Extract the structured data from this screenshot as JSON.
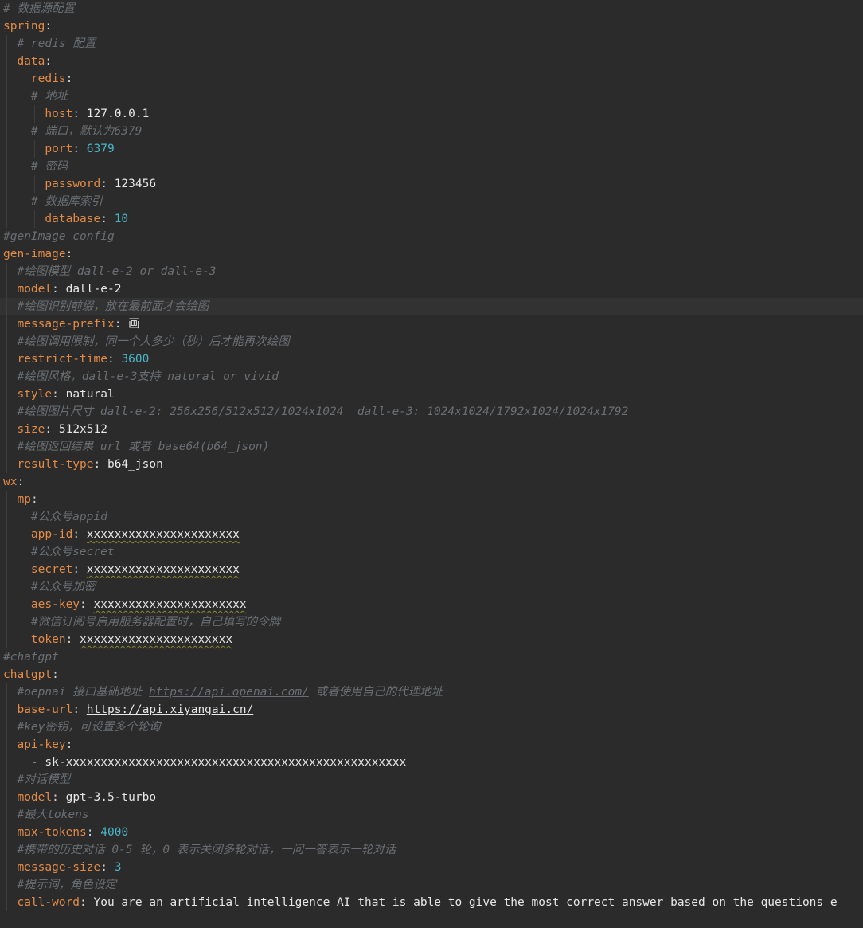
{
  "lines": [
    {
      "indent": 0,
      "parts": [
        {
          "t": "c",
          "v": "# 数据源配置"
        }
      ]
    },
    {
      "indent": 0,
      "parts": [
        {
          "t": "k",
          "v": "spring"
        },
        {
          "t": "p",
          "v": ":"
        }
      ]
    },
    {
      "indent": 1,
      "parts": [
        {
          "t": "c",
          "v": "# redis 配置"
        }
      ]
    },
    {
      "indent": 1,
      "parts": [
        {
          "t": "k",
          "v": "data"
        },
        {
          "t": "p",
          "v": ":"
        }
      ]
    },
    {
      "indent": 2,
      "parts": [
        {
          "t": "k",
          "v": "redis"
        },
        {
          "t": "p",
          "v": ":"
        }
      ]
    },
    {
      "indent": 2,
      "parts": [
        {
          "t": "c",
          "v": "# 地址"
        }
      ]
    },
    {
      "indent": 3,
      "parts": [
        {
          "t": "k",
          "v": "host"
        },
        {
          "t": "p",
          "v": ": "
        },
        {
          "t": "s",
          "v": "127.0.0.1"
        }
      ]
    },
    {
      "indent": 2,
      "parts": [
        {
          "t": "c",
          "v": "# 端口，默认为6379"
        }
      ]
    },
    {
      "indent": 3,
      "parts": [
        {
          "t": "k",
          "v": "port"
        },
        {
          "t": "p",
          "v": ": "
        },
        {
          "t": "n",
          "v": "6379"
        }
      ]
    },
    {
      "indent": 2,
      "parts": [
        {
          "t": "c",
          "v": "# 密码"
        }
      ]
    },
    {
      "indent": 3,
      "parts": [
        {
          "t": "k",
          "v": "password"
        },
        {
          "t": "p",
          "v": ": "
        },
        {
          "t": "s",
          "v": "123456"
        }
      ]
    },
    {
      "indent": 2,
      "parts": [
        {
          "t": "c",
          "v": "# 数据库索引"
        }
      ]
    },
    {
      "indent": 3,
      "parts": [
        {
          "t": "k",
          "v": "database"
        },
        {
          "t": "p",
          "v": ": "
        },
        {
          "t": "n",
          "v": "10"
        }
      ]
    },
    {
      "indent": 0,
      "parts": [
        {
          "t": "c",
          "v": "#genImage config"
        }
      ]
    },
    {
      "indent": 0,
      "parts": [
        {
          "t": "k",
          "v": "gen-image"
        },
        {
          "t": "p",
          "v": ":"
        }
      ]
    },
    {
      "indent": 1,
      "parts": [
        {
          "t": "c",
          "v": "#绘图模型 dall-e-2 or dall-e-3"
        }
      ]
    },
    {
      "indent": 1,
      "parts": [
        {
          "t": "k",
          "v": "model"
        },
        {
          "t": "p",
          "v": ": "
        },
        {
          "t": "s",
          "v": "dall-e-2"
        }
      ]
    },
    {
      "indent": 1,
      "current": true,
      "parts": [
        {
          "t": "c",
          "v": "#绘图识别前缀，放在最前面才会绘图"
        }
      ]
    },
    {
      "indent": 1,
      "parts": [
        {
          "t": "k",
          "v": "message-prefix"
        },
        {
          "t": "p",
          "v": ": "
        },
        {
          "t": "s",
          "v": "画"
        }
      ]
    },
    {
      "indent": 1,
      "parts": [
        {
          "t": "c",
          "v": "#绘图调用限制，同一个人多少（秒）后才能再次绘图"
        }
      ]
    },
    {
      "indent": 1,
      "parts": [
        {
          "t": "k",
          "v": "restrict-time"
        },
        {
          "t": "p",
          "v": ": "
        },
        {
          "t": "n",
          "v": "3600"
        }
      ]
    },
    {
      "indent": 1,
      "parts": [
        {
          "t": "c",
          "v": "#绘图风格，dall-e-3支持 natural or vivid"
        }
      ]
    },
    {
      "indent": 1,
      "parts": [
        {
          "t": "k",
          "v": "style"
        },
        {
          "t": "p",
          "v": ": "
        },
        {
          "t": "s",
          "v": "natural"
        }
      ]
    },
    {
      "indent": 1,
      "parts": [
        {
          "t": "c",
          "v": "#绘图图片尺寸 dall-e-2: 256x256/512x512/1024x1024  dall-e-3: 1024x1024/1792x1024/1024x1792"
        }
      ]
    },
    {
      "indent": 1,
      "parts": [
        {
          "t": "k",
          "v": "size"
        },
        {
          "t": "p",
          "v": ": "
        },
        {
          "t": "s",
          "v": "512x512"
        }
      ]
    },
    {
      "indent": 1,
      "parts": [
        {
          "t": "c",
          "v": "#绘图返回结果 url 或者 base64(b64_json)"
        }
      ]
    },
    {
      "indent": 1,
      "parts": [
        {
          "t": "k",
          "v": "result-type"
        },
        {
          "t": "p",
          "v": ": "
        },
        {
          "t": "s",
          "v": "b64_json"
        }
      ]
    },
    {
      "indent": 0,
      "parts": [
        {
          "t": "k",
          "v": "wx"
        },
        {
          "t": "p",
          "v": ":"
        }
      ]
    },
    {
      "indent": 1,
      "parts": [
        {
          "t": "k",
          "v": "mp"
        },
        {
          "t": "p",
          "v": ":"
        }
      ]
    },
    {
      "indent": 2,
      "parts": [
        {
          "t": "c",
          "v": "#公众号appid"
        }
      ]
    },
    {
      "indent": 2,
      "parts": [
        {
          "t": "k",
          "v": "app-id"
        },
        {
          "t": "p",
          "v": ": "
        },
        {
          "t": "sw",
          "v": "xxxxxxxxxxxxxxxxxxxxxx"
        }
      ]
    },
    {
      "indent": 2,
      "parts": [
        {
          "t": "c",
          "v": "#公众号secret"
        }
      ]
    },
    {
      "indent": 2,
      "parts": [
        {
          "t": "k",
          "v": "secret"
        },
        {
          "t": "p",
          "v": ": "
        },
        {
          "t": "sw",
          "v": "xxxxxxxxxxxxxxxxxxxxxx"
        }
      ]
    },
    {
      "indent": 2,
      "parts": [
        {
          "t": "c",
          "v": "#公众号加密"
        }
      ]
    },
    {
      "indent": 2,
      "parts": [
        {
          "t": "k",
          "v": "aes-key"
        },
        {
          "t": "p",
          "v": ": "
        },
        {
          "t": "sw",
          "v": "xxxxxxxxxxxxxxxxxxxxxx"
        }
      ]
    },
    {
      "indent": 2,
      "parts": [
        {
          "t": "c",
          "v": "#微信订阅号启用服务器配置时，自己填写的令牌"
        }
      ]
    },
    {
      "indent": 2,
      "parts": [
        {
          "t": "k",
          "v": "token"
        },
        {
          "t": "p",
          "v": ": "
        },
        {
          "t": "sw",
          "v": "xxxxxxxxxxxxxxxxxxxxxx"
        }
      ]
    },
    {
      "indent": 0,
      "parts": [
        {
          "t": "c",
          "v": "#chatgpt"
        }
      ]
    },
    {
      "indent": 0,
      "parts": [
        {
          "t": "k",
          "v": "chatgpt"
        },
        {
          "t": "p",
          "v": ":"
        }
      ]
    },
    {
      "indent": 1,
      "parts": [
        {
          "t": "c",
          "v": "#oepnai 接口基础地址 "
        },
        {
          "t": "cu",
          "v": "https://api.openai.com/"
        },
        {
          "t": "c",
          "v": " 或者使用自己的代理地址"
        }
      ]
    },
    {
      "indent": 1,
      "parts": [
        {
          "t": "k",
          "v": "base-url"
        },
        {
          "t": "p",
          "v": ": "
        },
        {
          "t": "su",
          "v": "https://api.xiyangai.cn/"
        }
      ]
    },
    {
      "indent": 1,
      "parts": [
        {
          "t": "c",
          "v": "#key密钥，可设置多个轮询"
        }
      ]
    },
    {
      "indent": 1,
      "parts": [
        {
          "t": "k",
          "v": "api-key"
        },
        {
          "t": "p",
          "v": ":"
        }
      ]
    },
    {
      "indent": 2,
      "parts": [
        {
          "t": "p",
          "v": "- "
        },
        {
          "t": "s",
          "v": "sk-xxxxxxxxxxxxxxxxxxxxxxxxxxxxxxxxxxxxxxxxxxxxxxxxx"
        }
      ]
    },
    {
      "indent": 1,
      "parts": [
        {
          "t": "c",
          "v": "#对话模型"
        }
      ]
    },
    {
      "indent": 1,
      "parts": [
        {
          "t": "k",
          "v": "model"
        },
        {
          "t": "p",
          "v": ": "
        },
        {
          "t": "s",
          "v": "gpt-3.5-turbo"
        }
      ]
    },
    {
      "indent": 1,
      "parts": [
        {
          "t": "c",
          "v": "#最大tokens"
        }
      ]
    },
    {
      "indent": 1,
      "parts": [
        {
          "t": "k",
          "v": "max-tokens"
        },
        {
          "t": "p",
          "v": ": "
        },
        {
          "t": "n",
          "v": "4000"
        }
      ]
    },
    {
      "indent": 1,
      "parts": [
        {
          "t": "c",
          "v": "#携带的历史对话 0-5 轮，0 表示关闭多轮对话，一问一答表示一轮对话"
        }
      ]
    },
    {
      "indent": 1,
      "parts": [
        {
          "t": "k",
          "v": "message-size"
        },
        {
          "t": "p",
          "v": ": "
        },
        {
          "t": "n",
          "v": "3"
        }
      ]
    },
    {
      "indent": 1,
      "parts": [
        {
          "t": "c",
          "v": "#提示词，角色设定"
        }
      ]
    },
    {
      "indent": 1,
      "parts": [
        {
          "t": "k",
          "v": "call-word"
        },
        {
          "t": "p",
          "v": ": "
        },
        {
          "t": "s",
          "v": "You are an artificial intelligence AI that is able to give the most correct answer based on the questions e"
        }
      ]
    }
  ]
}
